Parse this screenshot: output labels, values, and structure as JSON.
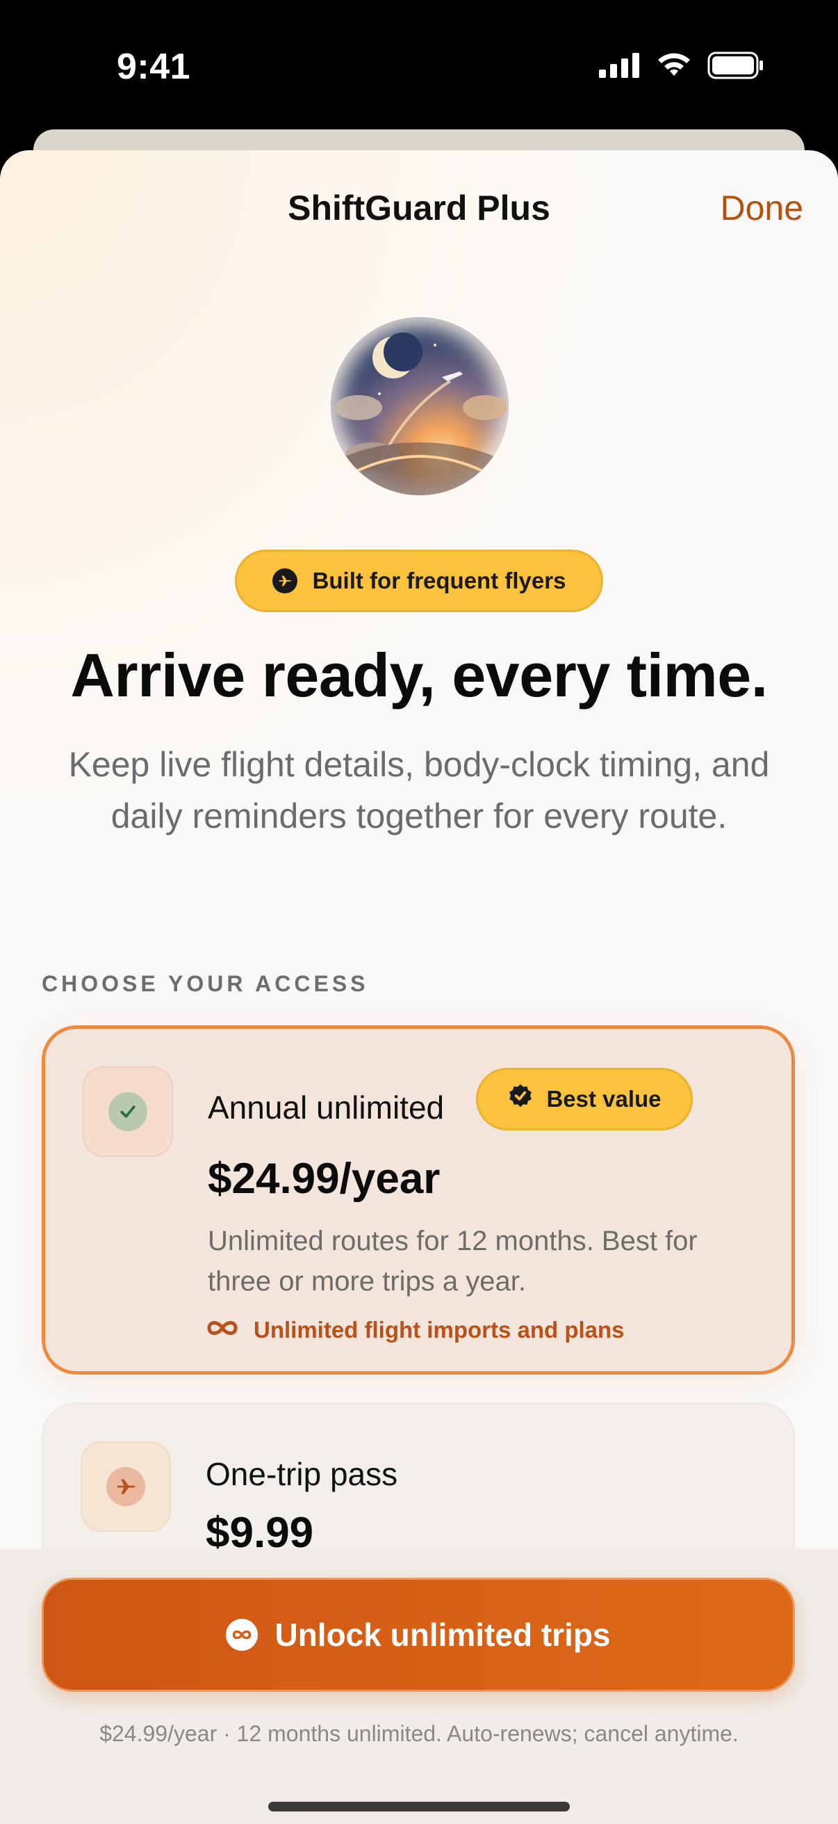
{
  "status_bar": {
    "time": "9:41"
  },
  "sheet": {
    "title": "ShiftGuard Plus",
    "done_label": "Done"
  },
  "hero": {
    "badge": "Built for frequent flyers",
    "headline": "Arrive ready, every time.",
    "subtitle": "Keep live flight details, body-clock timing, and daily reminders together for every route."
  },
  "plans": {
    "section_label": "CHOOSE YOUR ACCESS",
    "items": [
      {
        "name": "Annual unlimited",
        "badge": "Best value",
        "price": "$24.99/year",
        "description": "Unlimited routes for 12 months. Best for three or more trips a year.",
        "feature": "Unlimited flight imports and plans",
        "selected": true,
        "icon": "checkmark-icon"
      },
      {
        "name": "One-trip pass",
        "price": "$9.99",
        "selected": false,
        "icon": "airplane-icon"
      }
    ]
  },
  "cta": {
    "label": "Unlock unlimited trips",
    "footnote": "$24.99/year · 12 months unlimited. Auto-renews; cancel anytime."
  },
  "colors": {
    "accent": "#cf5514",
    "badge_yellow": "#fbc23e",
    "selected_border": "#ed8a3f",
    "done_text": "#b5510f"
  }
}
